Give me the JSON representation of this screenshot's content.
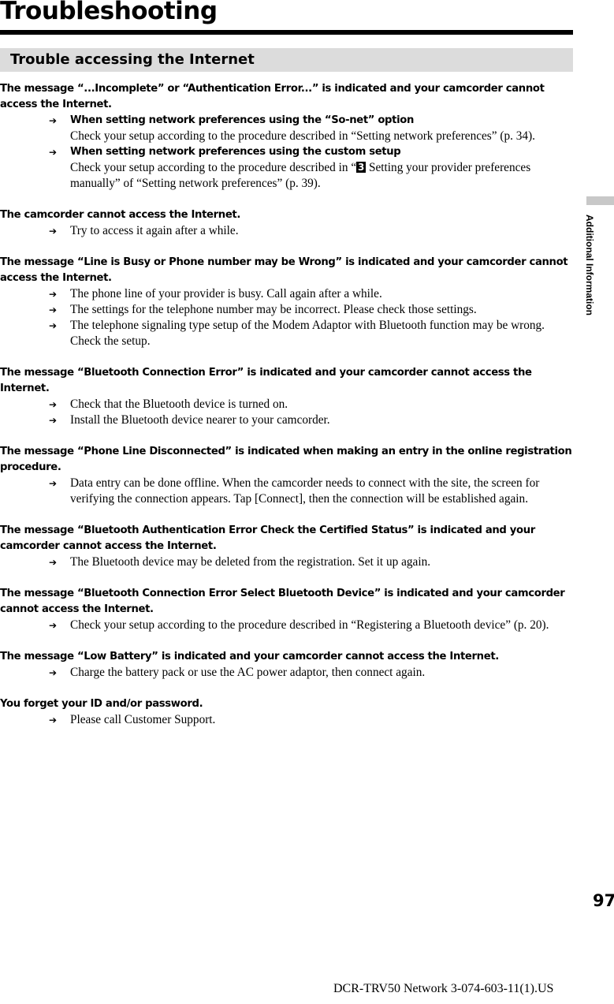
{
  "page": {
    "title": "Troubleshooting",
    "section_title": "Trouble accessing the Internet",
    "side_tab_label": "Additional Information",
    "page_number": "97",
    "footer": "DCR-TRV50 Network 3-074-603-11(1).US"
  },
  "entries": [
    {
      "question": "The message “...Incomplete” or “Authentication Error...” is indicated and your camcorder cannot access the Internet.",
      "answers": [
        {
          "subheading": "When setting network preferences using the “So-net” option",
          "text": "Check your setup according to the procedure described in “Setting network preferences” (p. 34)."
        },
        {
          "subheading": "When setting network preferences using the custom setup",
          "text_before": "Check your setup according to the procedure described in “",
          "step_number": "3",
          "text_after": " Setting your provider preferences manually” of “Setting network preferences” (p. 39)."
        }
      ]
    },
    {
      "question": "The camcorder cannot access the Internet.",
      "answers": [
        {
          "text": "Try to access it again after a while."
        }
      ]
    },
    {
      "question": "The message “Line is Busy or Phone number may be Wrong” is indicated and your camcorder cannot access the Internet.",
      "answers": [
        {
          "text": "The phone line of your provider is busy. Call again after a while."
        },
        {
          "text": "The settings for the telephone number may be incorrect. Please check those settings."
        },
        {
          "text": "The telephone signaling type setup of the Modem Adaptor with Bluetooth function may be wrong. Check the setup."
        }
      ]
    },
    {
      "question": "The message “Bluetooth Connection Error” is indicated and your camcorder cannot access the Internet.",
      "answers": [
        {
          "text": "Check that the Bluetooth device is turned on."
        },
        {
          "text": "Install the Bluetooth device nearer to your camcorder."
        }
      ]
    },
    {
      "question": "The message “Phone Line Disconnected” is indicated when making an entry in the online registration procedure.",
      "answers": [
        {
          "text": "Data entry can be done offline. When the camcorder needs to connect with the site, the screen for verifying the connection appears. Tap [Connect], then the connection will be established again."
        }
      ]
    },
    {
      "question": "The message “Bluetooth Authentication Error Check the Certified Status” is indicated and your camcorder cannot access the Internet.",
      "answers": [
        {
          "text": "The Bluetooth device may be deleted from the registration. Set it up again."
        }
      ]
    },
    {
      "question": "The message “Bluetooth Connection Error Select Bluetooth Device” is indicated and your camcorder cannot access the Internet.",
      "answers": [
        {
          "text": "Check your setup according to the procedure described in “Registering a Bluetooth device” (p. 20)."
        }
      ]
    },
    {
      "question": "The message “Low Battery” is indicated and your camcorder cannot access the Internet.",
      "answers": [
        {
          "text": "Charge the battery pack or use the AC power adaptor, then connect again."
        }
      ]
    },
    {
      "question": "You forget your ID and/or password.",
      "answers": [
        {
          "text": "Please call Customer Support."
        }
      ]
    }
  ],
  "icons": {
    "bullet": "arrow-right-icon",
    "bullet_glyph": "➔"
  }
}
